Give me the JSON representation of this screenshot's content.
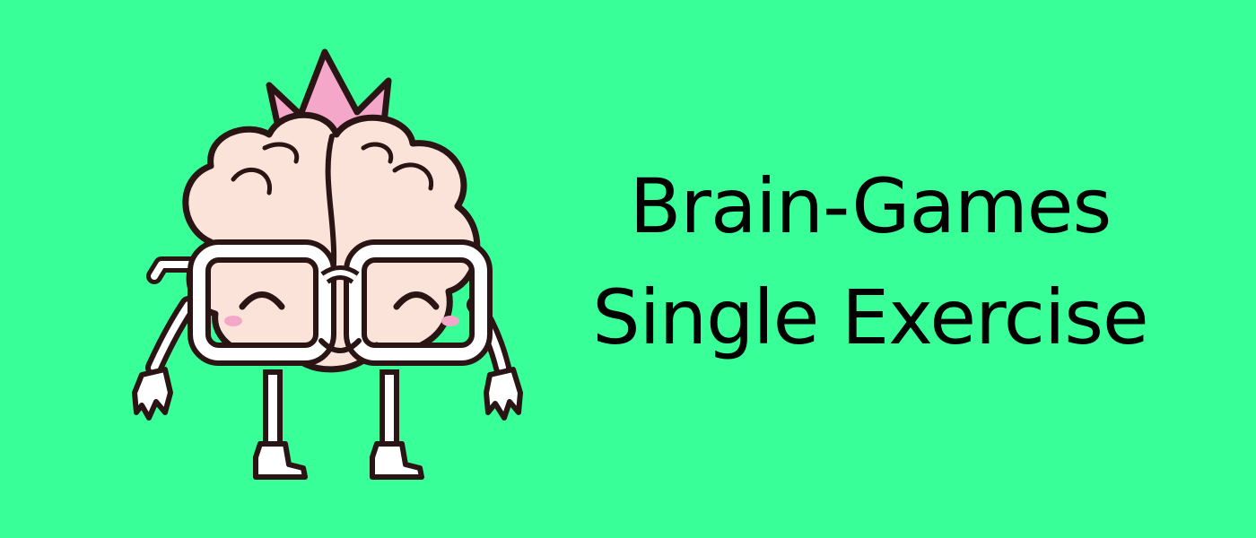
{
  "banner": {
    "title_line_1": "Brain-Games",
    "title_line_2": "Single Exercise",
    "background_color": "#39ff99",
    "text_color": "#000000"
  },
  "mascot": {
    "icon": "brain-mascot-with-crown-and-glasses",
    "crown_color": "#f4a7c8",
    "brain_color": "#fbe3d9"
  }
}
